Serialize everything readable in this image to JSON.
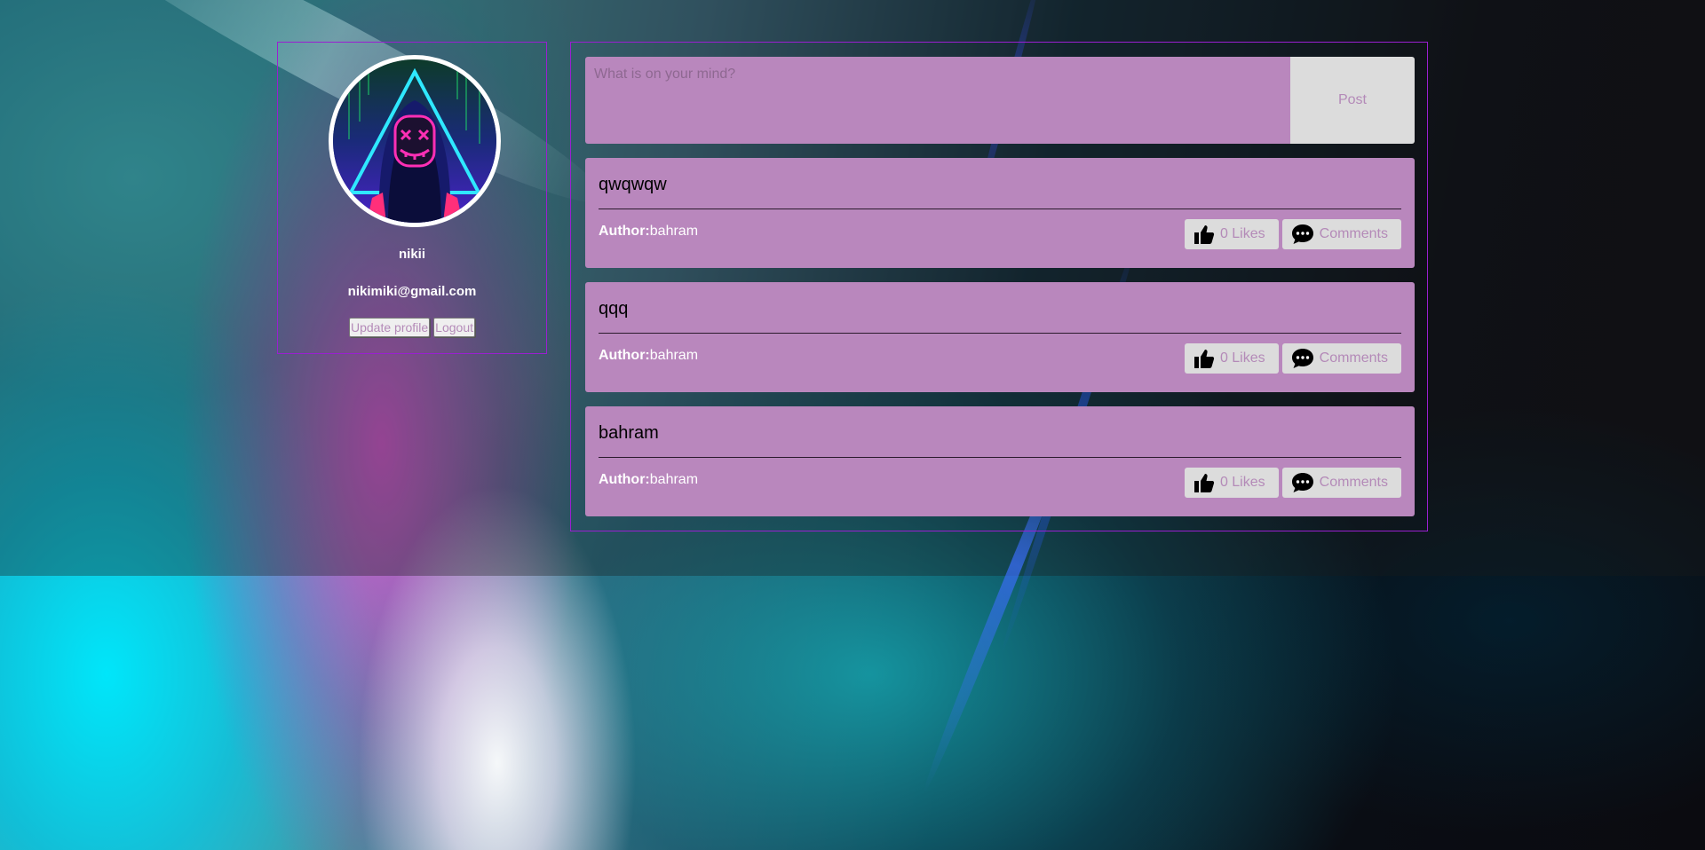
{
  "profile": {
    "name": "nikii",
    "email": "nikimiki@gmail.com",
    "update_label": "Update profile",
    "logout_label": "Logout",
    "avatar_icon": "hooded-figure-neon-mask"
  },
  "composer": {
    "placeholder": "What is on your mind?",
    "value": "",
    "post_label": "Post"
  },
  "posts": [
    {
      "title": "qwqwqw",
      "author_label": "Author:",
      "author": "bahram",
      "likes_label": "0 Likes",
      "comments_label": "Comments"
    },
    {
      "title": "qqq",
      "author_label": "Author:",
      "author": "bahram",
      "likes_label": "0 Likes",
      "comments_label": "Comments"
    },
    {
      "title": "bahram",
      "author_label": "Author:",
      "author": "bahram",
      "likes_label": "0 Likes",
      "comments_label": "Comments"
    }
  ],
  "icons": {
    "like": "thumbs-up-icon",
    "comments": "speech-bubble-icon"
  },
  "colors": {
    "panel_border": "#9a1fd1",
    "card_bg": "#b987bd",
    "button_bg": "#dcdcdc",
    "button_text": "#b48ab8"
  }
}
